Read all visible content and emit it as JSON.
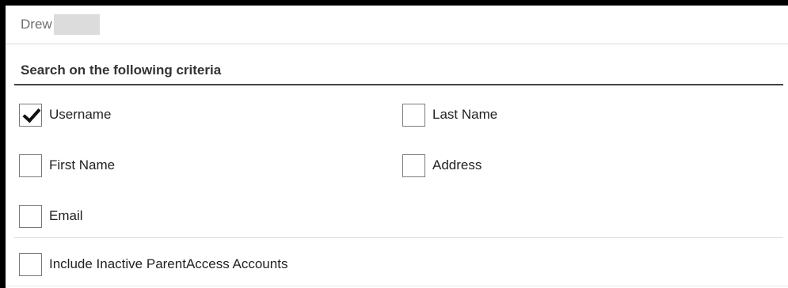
{
  "search": {
    "value": "Drew"
  },
  "criteria": {
    "title": "Search on the following criteria",
    "options": [
      {
        "label": "Username",
        "checked": true
      },
      {
        "label": "Last Name",
        "checked": false
      },
      {
        "label": "First Name",
        "checked": false
      },
      {
        "label": "Address",
        "checked": false
      },
      {
        "label": "Email",
        "checked": false
      }
    ]
  },
  "inactive": {
    "label": "Include Inactive ParentAccess Accounts",
    "checked": false
  },
  "icons": {
    "checkmark": "checkmark-icon"
  }
}
